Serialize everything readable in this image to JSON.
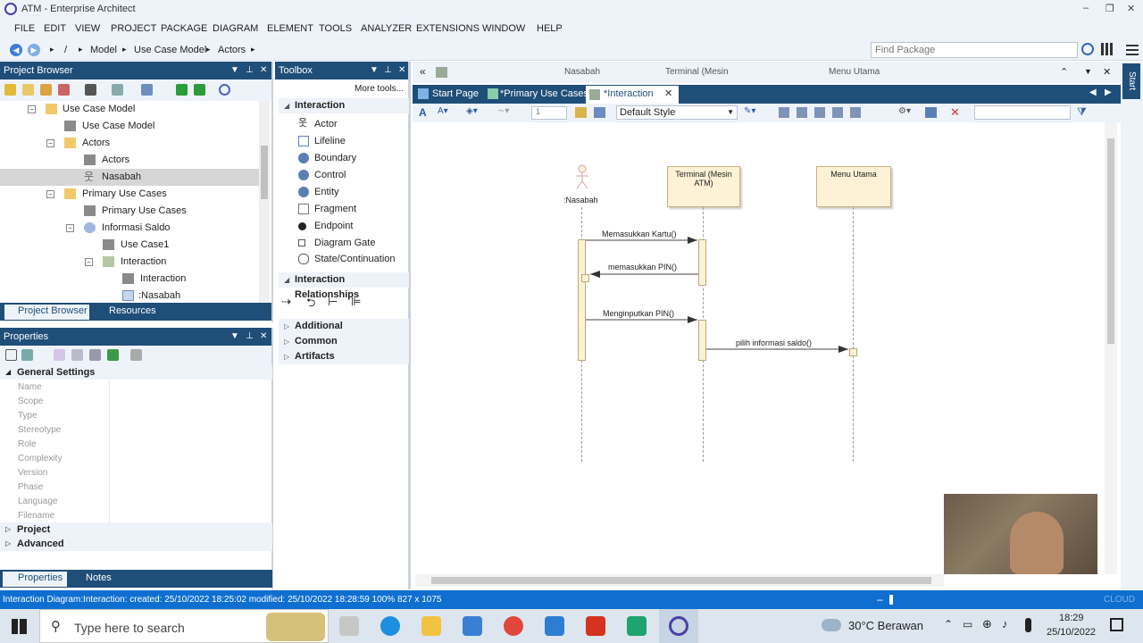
{
  "window": {
    "title": "ATM - Enterprise Architect",
    "controls": [
      "–",
      "❐",
      "✕"
    ]
  },
  "menu": [
    "FILE",
    "EDIT",
    "VIEW",
    "PROJECT",
    "PACKAGE",
    "DIAGRAM",
    "ELEMENT",
    "TOOLS",
    "ANALYZER",
    "EXTENSIONS",
    "WINDOW",
    "HELP"
  ],
  "breadcrumb": {
    "root": "/",
    "items": [
      "Model",
      "Use Case Model",
      "Actors"
    ]
  },
  "find_package": {
    "placeholder": "Find Package"
  },
  "project_browser": {
    "title": "Project Browser",
    "tree": [
      {
        "label": "Use Case Model",
        "expander": "−"
      },
      {
        "label": "Use Case Model",
        "expander": ""
      },
      {
        "label": "Actors",
        "expander": "−"
      },
      {
        "label": "Actors",
        "expander": ""
      },
      {
        "label": "Nasabah",
        "expander": ""
      },
      {
        "label": "Primary Use Cases",
        "expander": "−"
      },
      {
        "label": "Primary Use Cases",
        "expander": ""
      },
      {
        "label": "Informasi Saldo",
        "expander": "−"
      },
      {
        "label": "Use Case1",
        "expander": ""
      },
      {
        "label": "Interaction",
        "expander": "−"
      },
      {
        "label": "Interaction",
        "expander": ""
      },
      {
        "label": ":Nasabah",
        "expander": ""
      }
    ],
    "tabs": [
      "Project Browser",
      "Resources"
    ]
  },
  "properties": {
    "title": "Properties",
    "section": "General Settings",
    "fields": [
      "Name",
      "Scope",
      "Type",
      "Stereotype",
      "Role",
      "Complexity",
      "Version",
      "Phase",
      "Language",
      "Filename"
    ],
    "groups": [
      "Project",
      "Advanced"
    ],
    "tabs": [
      "Properties",
      "Notes"
    ]
  },
  "toolbox": {
    "title": "Toolbox",
    "more_tools": "More tools...",
    "section_interaction": "Interaction",
    "items": [
      "Actor",
      "Lifeline",
      "Boundary",
      "Control",
      "Entity",
      "Fragment",
      "Endpoint",
      "Diagram Gate",
      "State/Continuation"
    ],
    "section_relationships": "Interaction Relationships",
    "collapsed_sections": [
      "Additional",
      "Common",
      "Artifacts"
    ]
  },
  "diagram_header": {
    "labels": [
      "Nasabah",
      "Terminal (Mesin",
      "Menu Utama"
    ]
  },
  "doc_tabs": [
    "Start Page",
    "*Primary Use Cases",
    "*Interaction"
  ],
  "diagram_toolbar": {
    "zoom_value": "1",
    "style": "Default Style"
  },
  "diagram": {
    "actor": ":Nasabah",
    "lifelines": [
      "Terminal (Mesin ATM)",
      "Menu Utama"
    ],
    "messages": [
      "Memasukkan Kartu()",
      "memasukkan PIN()",
      "Menginputkan PIN()",
      "pilih informasi saldo()"
    ]
  },
  "side_tab": "Start",
  "statusbar": {
    "text": "Interaction Diagram:Interaction:   created: 25/10/2022 18:25:02  modified: 25/10/2022 18:28:59   100%   827 x 1075",
    "right": "CLOUD"
  },
  "taskbar": {
    "search_placeholder": "Type here to search",
    "weather": "30°C  Berawan",
    "time": "18:29",
    "date": "25/10/2022"
  },
  "colors": {
    "panel_header": "#1f4e79",
    "status_bar": "#0e6fd1",
    "lifeline_fill": "#fdf2d6"
  }
}
